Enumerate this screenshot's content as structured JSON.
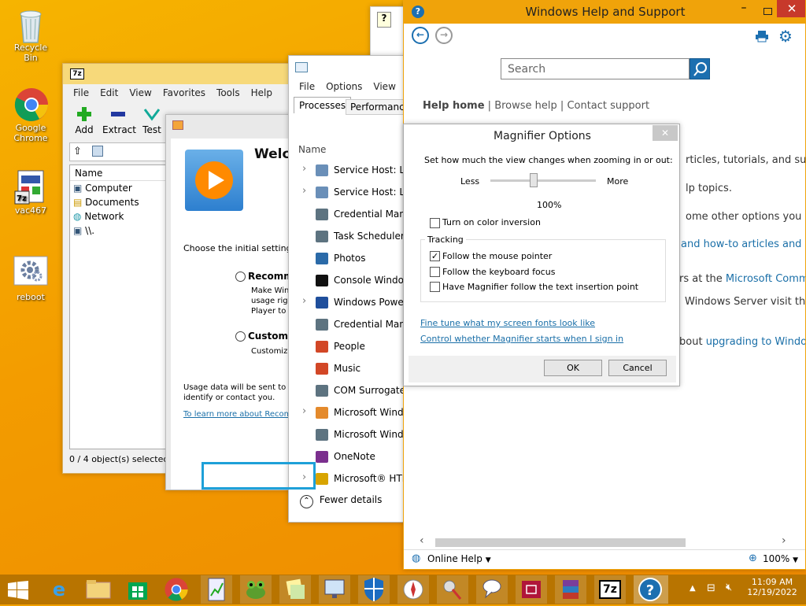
{
  "desktop_icons": [
    {
      "label": "Recycle Bin"
    },
    {
      "label": "Google Chrome"
    },
    {
      "label": "vac467"
    },
    {
      "label": "reboot"
    }
  ],
  "sevenzip": {
    "title_icon": "7z",
    "menu": [
      "File",
      "Edit",
      "View",
      "Favorites",
      "Tools",
      "Help"
    ],
    "toolbar": [
      "Add",
      "Extract",
      "Test"
    ],
    "column_name": "Name",
    "items": [
      "Computer",
      "Documents",
      "Network",
      "\\\\."
    ],
    "status": "0 / 4 object(s) selected"
  },
  "wmp": {
    "welcome": "Welcome",
    "choose": "Choose the initial settings f",
    "recommended": "Recommen",
    "rec_desc": [
      "Make Win",
      "usage righ",
      "Player to"
    ],
    "custom": "Custom s",
    "custom_desc": "Customize",
    "usage": [
      "Usage data will be sent to M",
      "identify or contact you."
    ],
    "learn": "To learn more about Recomm"
  },
  "taskmgr": {
    "menu": [
      "File",
      "Options",
      "View"
    ],
    "tabs": [
      "Processes",
      "Performance"
    ],
    "column": "Name",
    "rows": [
      "Service Host: Loc",
      "Service Host: Loc",
      "Credential Manag",
      "Task Scheduler E",
      "Photos",
      "Console Window",
      "Windows PowerS",
      "Credential Manag",
      "People",
      "Music",
      "COM Surrogate (",
      "Microsoft Windo",
      "Microsoft Windo",
      "OneNote",
      "Microsoft® HTM"
    ],
    "expandable": [
      true,
      true,
      false,
      false,
      false,
      false,
      true,
      false,
      false,
      false,
      false,
      true,
      false,
      false,
      true
    ],
    "fewer": "Fewer details"
  },
  "help": {
    "title": "Windows Help and Support",
    "search_placeholder": "Search",
    "nav": {
      "home": "Help home",
      "browse": "Browse help",
      "contact": "Contact support"
    },
    "lines": [
      {
        "text": "rticles, tutorials, and suppo",
        "link": false
      },
      {
        "text": "lp topics.",
        "link": false
      },
      {
        "text": "ome other options you can",
        "link": false
      },
      {
        "text": "and how-to articles and vi",
        "link": true
      },
      {
        "text": "rs at the ",
        "link": false,
        "tail": "Microsoft Commu"
      },
      {
        "text": "Windows Server visit the",
        "link": false
      },
      {
        "text": "bout ",
        "link": false,
        "tail": "upgrading to Window"
      }
    ],
    "online_help": "Online Help",
    "zoom": "100%"
  },
  "magnifier": {
    "title": "Magnifier Options",
    "zoom_prompt": "Set how much the view changes when zooming in or out:",
    "less": "Less",
    "more": "More",
    "zoom_value": "100%",
    "zoom_fraction": 0.4,
    "color_inversion": "Turn on color inversion",
    "color_inversion_checked": false,
    "tracking": "Tracking",
    "options": [
      {
        "label": "Follow the mouse pointer",
        "checked": true
      },
      {
        "label": "Follow the keyboard focus",
        "checked": false
      },
      {
        "label": "Have Magnifier follow the text insertion point",
        "checked": false
      }
    ],
    "links": [
      "Fine tune what my screen fonts look like",
      "Control whether Magnifier starts when I sign in"
    ],
    "ok": "OK",
    "cancel": "Cancel"
  },
  "taskbar": {
    "time": "11:09 AM",
    "date": "12/19/2022",
    "sevenzip_label": "7z"
  },
  "colors": {
    "accent": "#f0a30a",
    "link": "#1a6fa8",
    "taskbar": "#b87400"
  }
}
